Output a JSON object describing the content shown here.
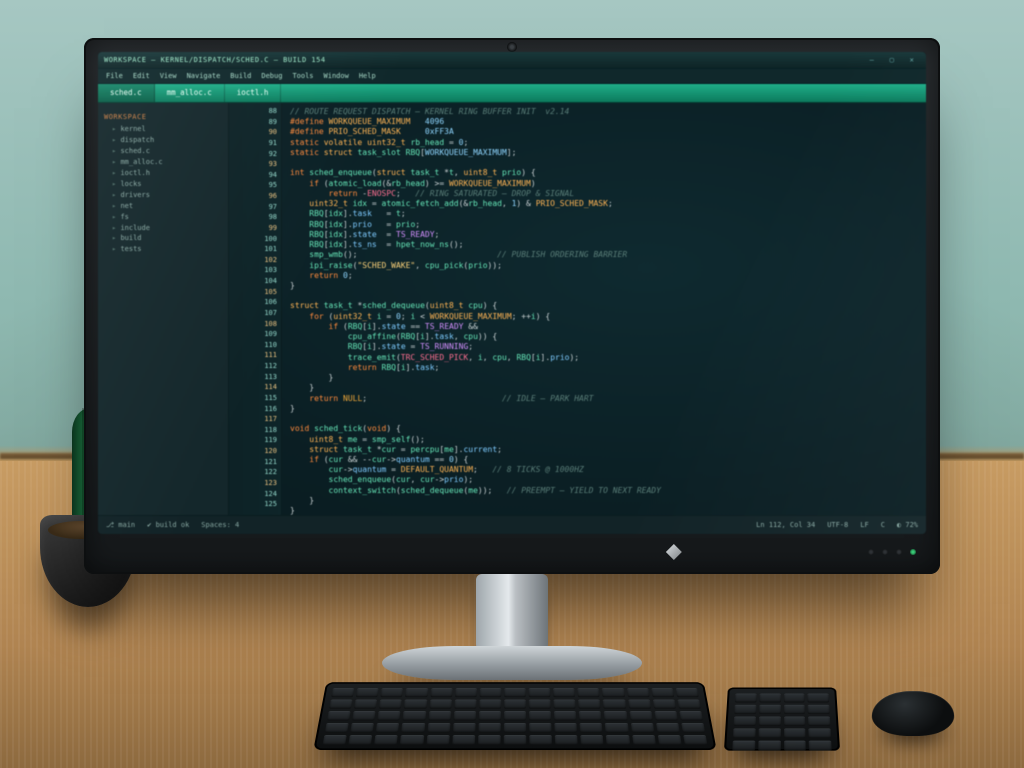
{
  "ide": {
    "title": "WORKSPACE — KERNEL/DISPATCH/SCHED.C — BUILD 154",
    "window_controls": [
      "–",
      "▢",
      "✕"
    ],
    "menu": [
      "File",
      "Edit",
      "View",
      "Navigate",
      "Build",
      "Debug",
      "Tools",
      "Window",
      "Help"
    ],
    "tabs": [
      {
        "label": "sched.c",
        "active": true
      },
      {
        "label": "mm_alloc.c",
        "active": false
      },
      {
        "label": "ioctl.h",
        "active": false
      }
    ],
    "sidebar": {
      "section": "WORKSPACE",
      "items": [
        "kernel",
        "dispatch",
        "sched.c",
        "mm_alloc.c",
        "ioctl.h",
        "locks",
        "drivers",
        "net",
        "fs",
        "include",
        "build",
        "tests"
      ]
    },
    "gutter_start": 88,
    "gutter_count": 38,
    "code_lines": [
      [
        [
          "cm",
          "// ROUTE REQUEST DISPATCH — KERNEL RING BUFFER INIT  v2.14"
        ]
      ],
      [
        [
          "kw",
          "#define "
        ],
        [
          "ty",
          "WORKQUEUE_MAXIMUM"
        ],
        [
          "pn",
          "   "
        ],
        [
          "num",
          "4096"
        ]
      ],
      [
        [
          "kw",
          "#define "
        ],
        [
          "ty",
          "PRIO_SCHED_MASK"
        ],
        [
          "pn",
          "     "
        ],
        [
          "num",
          "0xFF3A"
        ]
      ],
      [
        [
          "kw",
          "static "
        ],
        [
          "ty",
          "volatile "
        ],
        [
          "ty",
          "uint32_t "
        ],
        [
          "fn",
          "rb_head"
        ],
        [
          "pn",
          " = "
        ],
        [
          "num",
          "0"
        ],
        [
          "pn",
          ";"
        ]
      ],
      [
        [
          "kw",
          "static "
        ],
        [
          "ty",
          "struct "
        ],
        [
          "fn",
          "task_slot"
        ],
        [
          "pn",
          " "
        ],
        [
          "fn",
          "RBQ"
        ],
        [
          "pn",
          "["
        ],
        [
          "num",
          "WORKQUEUE_MAXIMUM"
        ],
        [
          "pn",
          "];"
        ]
      ],
      [],
      [
        [
          "kw",
          "int "
        ],
        [
          "fn",
          "sched_enqueue"
        ],
        [
          "pn",
          "("
        ],
        [
          "ty",
          "struct "
        ],
        [
          "fn",
          "task_t"
        ],
        [
          "pn",
          " *"
        ],
        [
          "fn",
          "t"
        ],
        [
          "pn",
          ", "
        ],
        [
          "ty",
          "uint8_t "
        ],
        [
          "fn",
          "prio"
        ],
        [
          "pn",
          ") {"
        ]
      ],
      [
        [
          "pn",
          "    "
        ],
        [
          "kw",
          "if"
        ],
        [
          "pn",
          " ("
        ],
        [
          "fn",
          "atomic_load"
        ],
        [
          "pn",
          "(&"
        ],
        [
          "fn",
          "rb_head"
        ],
        [
          "pn",
          ") >= "
        ],
        [
          "ty",
          "WORKQUEUE_MAXIMUM"
        ],
        [
          "pn",
          ")"
        ]
      ],
      [
        [
          "pn",
          "        "
        ],
        [
          "kw",
          "return"
        ],
        [
          "pn",
          " -"
        ],
        [
          "hi",
          "ENOSPC"
        ],
        [
          "pn",
          ";   "
        ],
        [
          "cm",
          "// RING SATURATED — DROP & SIGNAL"
        ]
      ],
      [
        [
          "pn",
          "    "
        ],
        [
          "ty",
          "uint32_t "
        ],
        [
          "fn",
          "idx"
        ],
        [
          "pn",
          " = "
        ],
        [
          "fn",
          "atomic_fetch_add"
        ],
        [
          "pn",
          "(&"
        ],
        [
          "fn",
          "rb_head"
        ],
        [
          "pn",
          ", "
        ],
        [
          "num",
          "1"
        ],
        [
          "pn",
          ") & "
        ],
        [
          "ty",
          "PRIO_SCHED_MASK"
        ],
        [
          "pn",
          ";"
        ]
      ],
      [
        [
          "pn",
          "    "
        ],
        [
          "fn",
          "RBQ"
        ],
        [
          "pn",
          "["
        ],
        [
          "fn",
          "idx"
        ],
        [
          "pn",
          "]."
        ],
        [
          "bl",
          "task"
        ],
        [
          "pn",
          "   = "
        ],
        [
          "fn",
          "t"
        ],
        [
          "pn",
          ";"
        ]
      ],
      [
        [
          "pn",
          "    "
        ],
        [
          "fn",
          "RBQ"
        ],
        [
          "pn",
          "["
        ],
        [
          "fn",
          "idx"
        ],
        [
          "pn",
          "]."
        ],
        [
          "bl",
          "prio"
        ],
        [
          "pn",
          "   = "
        ],
        [
          "fn",
          "prio"
        ],
        [
          "pn",
          ";"
        ]
      ],
      [
        [
          "pn",
          "    "
        ],
        [
          "fn",
          "RBQ"
        ],
        [
          "pn",
          "["
        ],
        [
          "fn",
          "idx"
        ],
        [
          "pn",
          "]."
        ],
        [
          "bl",
          "state"
        ],
        [
          "pn",
          "  = "
        ],
        [
          "mg",
          "TS_READY"
        ],
        [
          "pn",
          ";"
        ]
      ],
      [
        [
          "pn",
          "    "
        ],
        [
          "fn",
          "RBQ"
        ],
        [
          "pn",
          "["
        ],
        [
          "fn",
          "idx"
        ],
        [
          "pn",
          "]."
        ],
        [
          "bl",
          "ts_ns"
        ],
        [
          "pn",
          "  = "
        ],
        [
          "fn",
          "hpet_now_ns"
        ],
        [
          "pn",
          "();"
        ]
      ],
      [
        [
          "pn",
          "    "
        ],
        [
          "fn",
          "smp_wmb"
        ],
        [
          "pn",
          "();                             "
        ],
        [
          "cm",
          "// PUBLISH ORDERING BARRIER"
        ]
      ],
      [
        [
          "pn",
          "    "
        ],
        [
          "fn",
          "ipi_raise"
        ],
        [
          "pn",
          "("
        ],
        [
          "str",
          "\"SCHED_WAKE\""
        ],
        [
          "pn",
          ", "
        ],
        [
          "fn",
          "cpu_pick"
        ],
        [
          "pn",
          "("
        ],
        [
          "fn",
          "prio"
        ],
        [
          "pn",
          "));"
        ]
      ],
      [
        [
          "pn",
          "    "
        ],
        [
          "kw",
          "return"
        ],
        [
          "pn",
          " "
        ],
        [
          "num",
          "0"
        ],
        [
          "pn",
          ";"
        ]
      ],
      [
        [
          "pn",
          "}"
        ]
      ],
      [],
      [
        [
          "ty",
          "struct "
        ],
        [
          "fn",
          "task_t"
        ],
        [
          "pn",
          " *"
        ],
        [
          "fn",
          "sched_dequeue"
        ],
        [
          "pn",
          "("
        ],
        [
          "ty",
          "uint8_t "
        ],
        [
          "fn",
          "cpu"
        ],
        [
          "pn",
          ") {"
        ]
      ],
      [
        [
          "pn",
          "    "
        ],
        [
          "kw",
          "for"
        ],
        [
          "pn",
          " ("
        ],
        [
          "ty",
          "uint32_t "
        ],
        [
          "fn",
          "i"
        ],
        [
          "pn",
          " = "
        ],
        [
          "num",
          "0"
        ],
        [
          "pn",
          "; "
        ],
        [
          "fn",
          "i"
        ],
        [
          "pn",
          " < "
        ],
        [
          "ty",
          "WORKQUEUE_MAXIMUM"
        ],
        [
          "pn",
          "; ++"
        ],
        [
          "fn",
          "i"
        ],
        [
          "pn",
          ") {"
        ]
      ],
      [
        [
          "pn",
          "        "
        ],
        [
          "kw",
          "if"
        ],
        [
          "pn",
          " ("
        ],
        [
          "fn",
          "RBQ"
        ],
        [
          "pn",
          "["
        ],
        [
          "fn",
          "i"
        ],
        [
          "pn",
          "]."
        ],
        [
          "bl",
          "state"
        ],
        [
          "pn",
          " == "
        ],
        [
          "mg",
          "TS_READY"
        ],
        [
          "pn",
          " &&"
        ]
      ],
      [
        [
          "pn",
          "            "
        ],
        [
          "fn",
          "cpu_affine"
        ],
        [
          "pn",
          "("
        ],
        [
          "fn",
          "RBQ"
        ],
        [
          "pn",
          "["
        ],
        [
          "fn",
          "i"
        ],
        [
          "pn",
          "]."
        ],
        [
          "bl",
          "task"
        ],
        [
          "pn",
          ", "
        ],
        [
          "fn",
          "cpu"
        ],
        [
          "pn",
          ")) {"
        ]
      ],
      [
        [
          "pn",
          "            "
        ],
        [
          "fn",
          "RBQ"
        ],
        [
          "pn",
          "["
        ],
        [
          "fn",
          "i"
        ],
        [
          "pn",
          "]."
        ],
        [
          "bl",
          "state"
        ],
        [
          "pn",
          " = "
        ],
        [
          "mg",
          "TS_RUNNING"
        ],
        [
          "pn",
          ";"
        ]
      ],
      [
        [
          "pn",
          "            "
        ],
        [
          "fn",
          "trace_emit"
        ],
        [
          "pn",
          "("
        ],
        [
          "hi",
          "TRC_SCHED_PICK"
        ],
        [
          "pn",
          ", "
        ],
        [
          "fn",
          "i"
        ],
        [
          "pn",
          ", "
        ],
        [
          "fn",
          "cpu"
        ],
        [
          "pn",
          ", "
        ],
        [
          "fn",
          "RBQ"
        ],
        [
          "pn",
          "["
        ],
        [
          "fn",
          "i"
        ],
        [
          "pn",
          "]."
        ],
        [
          "bl",
          "prio"
        ],
        [
          "pn",
          ");"
        ]
      ],
      [
        [
          "pn",
          "            "
        ],
        [
          "kw",
          "return"
        ],
        [
          "pn",
          " "
        ],
        [
          "fn",
          "RBQ"
        ],
        [
          "pn",
          "["
        ],
        [
          "fn",
          "i"
        ],
        [
          "pn",
          "]."
        ],
        [
          "bl",
          "task"
        ],
        [
          "pn",
          ";"
        ]
      ],
      [
        [
          "pn",
          "        }"
        ]
      ],
      [
        [
          "pn",
          "    }"
        ]
      ],
      [
        [
          "pn",
          "    "
        ],
        [
          "kw",
          "return"
        ],
        [
          "pn",
          " "
        ],
        [
          "wa",
          "NULL"
        ],
        [
          "pn",
          ";                            "
        ],
        [
          "cm",
          "// IDLE — PARK HART"
        ]
      ],
      [
        [
          "pn",
          "}"
        ]
      ],
      [],
      [
        [
          "kw",
          "void "
        ],
        [
          "fn",
          "sched_tick"
        ],
        [
          "pn",
          "("
        ],
        [
          "kw",
          "void"
        ],
        [
          "pn",
          ") {"
        ]
      ],
      [
        [
          "pn",
          "    "
        ],
        [
          "ty",
          "uint8_t "
        ],
        [
          "fn",
          "me"
        ],
        [
          "pn",
          " = "
        ],
        [
          "fn",
          "smp_self"
        ],
        [
          "pn",
          "();"
        ]
      ],
      [
        [
          "pn",
          "    "
        ],
        [
          "ty",
          "struct "
        ],
        [
          "fn",
          "task_t"
        ],
        [
          "pn",
          " *"
        ],
        [
          "fn",
          "cur"
        ],
        [
          "pn",
          " = "
        ],
        [
          "fn",
          "percpu"
        ],
        [
          "pn",
          "["
        ],
        [
          "fn",
          "me"
        ],
        [
          "pn",
          "]."
        ],
        [
          "bl",
          "current"
        ],
        [
          "pn",
          ";"
        ]
      ],
      [
        [
          "pn",
          "    "
        ],
        [
          "kw",
          "if"
        ],
        [
          "pn",
          " ("
        ],
        [
          "fn",
          "cur"
        ],
        [
          "pn",
          " && --"
        ],
        [
          "fn",
          "cur"
        ],
        [
          "pn",
          "->"
        ],
        [
          "bl",
          "quantum"
        ],
        [
          "pn",
          " == "
        ],
        [
          "num",
          "0"
        ],
        [
          "pn",
          ") {"
        ]
      ],
      [
        [
          "pn",
          "        "
        ],
        [
          "fn",
          "cur"
        ],
        [
          "pn",
          "->"
        ],
        [
          "bl",
          "quantum"
        ],
        [
          "pn",
          " = "
        ],
        [
          "ty",
          "DEFAULT_QUANTUM"
        ],
        [
          "pn",
          ";   "
        ],
        [
          "cm",
          "// 8 TICKS @ 1000HZ"
        ]
      ],
      [
        [
          "pn",
          "        "
        ],
        [
          "fn",
          "sched_enqueue"
        ],
        [
          "pn",
          "("
        ],
        [
          "fn",
          "cur"
        ],
        [
          "pn",
          ", "
        ],
        [
          "fn",
          "cur"
        ],
        [
          "pn",
          "->"
        ],
        [
          "bl",
          "prio"
        ],
        [
          "pn",
          ");"
        ]
      ],
      [
        [
          "pn",
          "        "
        ],
        [
          "fn",
          "context_switch"
        ],
        [
          "pn",
          "("
        ],
        [
          "fn",
          "sched_dequeue"
        ],
        [
          "pn",
          "("
        ],
        [
          "fn",
          "me"
        ],
        [
          "pn",
          "));   "
        ],
        [
          "cm",
          "// PREEMPT — YIELD TO NEXT READY"
        ]
      ],
      [
        [
          "pn",
          "    }"
        ]
      ],
      [
        [
          "pn",
          "}"
        ]
      ]
    ],
    "status": {
      "left": [
        "⎇ main",
        "✔ build ok",
        "Spaces: 4"
      ],
      "right": [
        "Ln 112, Col 34",
        "UTF-8",
        "LF",
        "C",
        "◐ 72%"
      ]
    }
  }
}
